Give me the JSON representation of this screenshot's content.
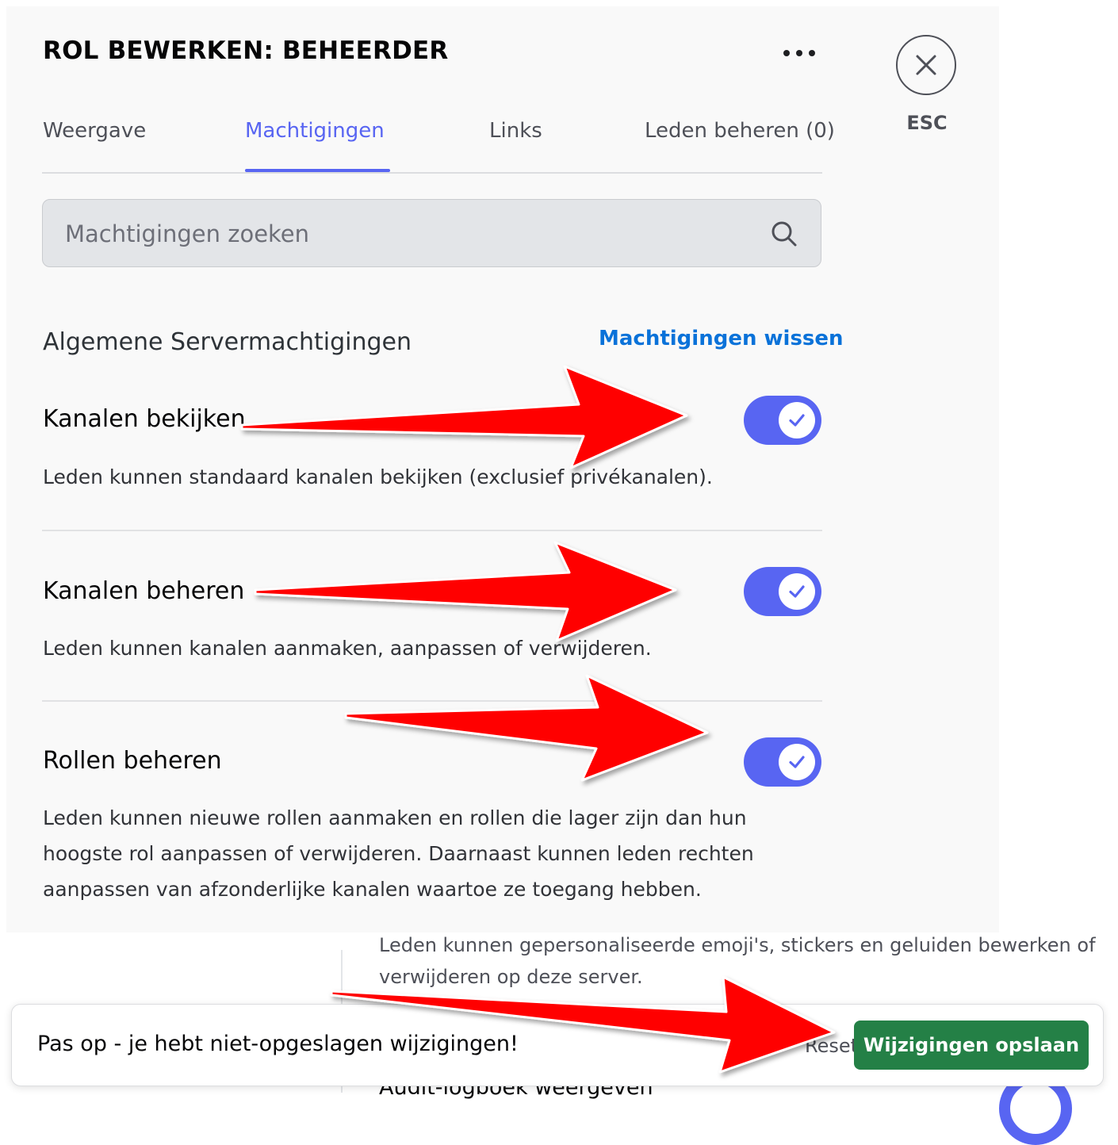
{
  "modal": {
    "title": "ROL BEWERKEN: BEHEERDER",
    "more_icon": "ellipsis-icon",
    "close_icon": "close-icon",
    "esc_label": "ESC"
  },
  "tabs": [
    {
      "label": "Weergave",
      "active": false
    },
    {
      "label": "Machtigingen",
      "active": true
    },
    {
      "label": "Links",
      "active": false
    },
    {
      "label": "Leden beheren (0)",
      "active": false
    }
  ],
  "search": {
    "placeholder": "Machtigingen zoeken",
    "value": "",
    "icon": "search-icon"
  },
  "section": {
    "title": "Algemene Servermachtigingen",
    "clear_label": "Machtigingen wissen"
  },
  "permissions": [
    {
      "title": "Kanalen bekijken",
      "description": "Leden kunnen standaard kanalen bekijken (exclusief privékanalen).",
      "enabled": true
    },
    {
      "title": "Kanalen beheren",
      "description": "Leden kunnen kanalen aanmaken, aanpassen of verwijderen.",
      "enabled": true
    },
    {
      "title": "Rollen beheren",
      "description": "Leden kunnen nieuwe rollen aanmaken en rollen die lager zijn dan hun hoogste rol aanpassen of verwijderen. Daarnaast kunnen leden rechten aanpassen van afzonderlijke kanalen waartoe ze toegang hebben.",
      "enabled": true
    }
  ],
  "lower": {
    "line1": "Leden kunnen gepersonaliseerde emoji's, stickers en geluiden bewerken of",
    "line2": "verwijderen op deze server.",
    "line3": "Audit-logboek weergeven"
  },
  "notice": {
    "message": "Pas op - je hebt niet-opgeslagen wijzigingen!",
    "reset_label": "Resetten",
    "save_label": "Wijzigingen opslaan"
  },
  "colors": {
    "accent": "#5865f2",
    "link": "#0a72d9",
    "save": "#248046",
    "annotation_arrow": "#ff0000"
  }
}
